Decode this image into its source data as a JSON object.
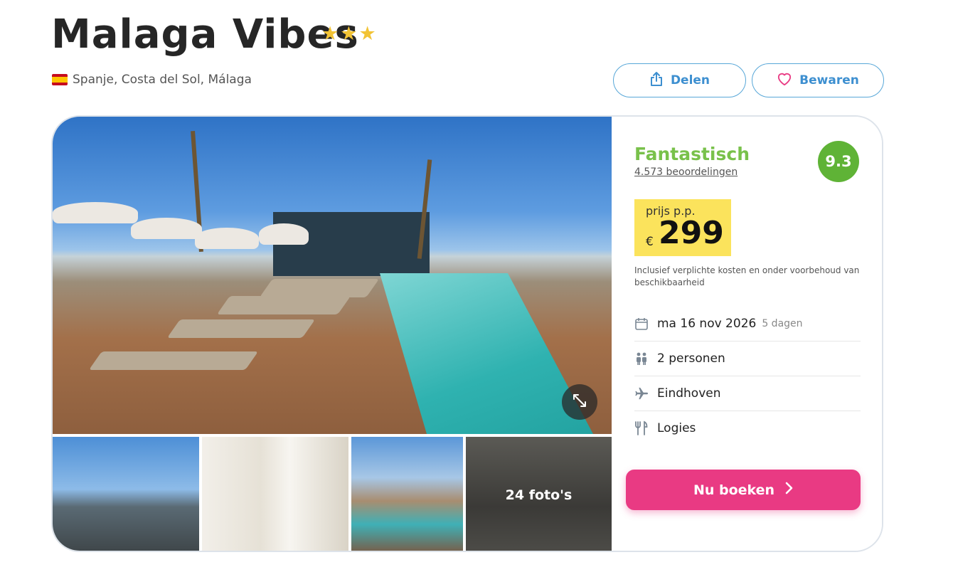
{
  "hotel": {
    "name": "Malaga Vibes",
    "star_count": 3,
    "stars": [
      "★",
      "★",
      "★"
    ],
    "location": "Spanje, Costa del Sol, Málaga",
    "flag": "spain-flag-icon"
  },
  "actions": {
    "share_label": "Delen",
    "save_label": "Bewaren"
  },
  "gallery": {
    "more_photos_label": "24 foto's"
  },
  "rating": {
    "label": "Fantastisch",
    "reviews": "4.573 beoordelingen",
    "score": "9.3"
  },
  "price": {
    "label": "prijs p.p.",
    "currency": "€",
    "amount": "299",
    "note": "Inclusief verplichte kosten en onder voorbehoud van beschikbaarheid"
  },
  "details": {
    "date": "ma 16 nov 2026",
    "duration": "5 dagen",
    "persons": "2 personen",
    "departure": "Eindhoven",
    "board": "Logies"
  },
  "booking": {
    "button_label": "Nu boeken"
  },
  "colors": {
    "accent_blue": "#3d8fd0",
    "booking_pink": "#e93a83",
    "rating_green": "#5fb336",
    "price_yellow": "#fbe35c",
    "star_gold": "#f2c335"
  }
}
